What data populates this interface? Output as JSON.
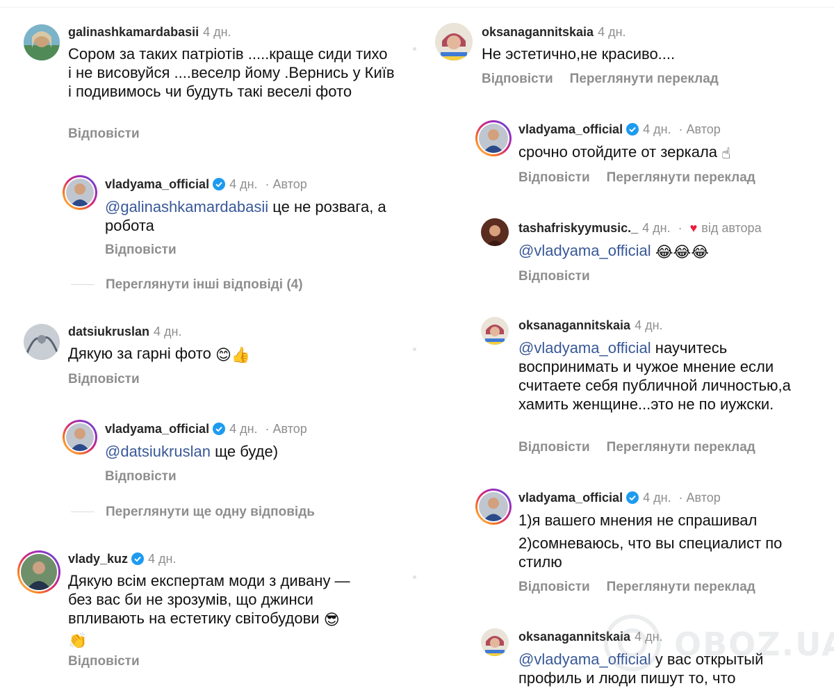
{
  "left_thread": [
    {
      "username": "galinashkamardabasii",
      "time": "4 дн.",
      "text": "Сором за таких патріотів .....краще сиди тихо і не висовуйся ....веселр йому .Вернись у Київ і  подивимось чи будуть такі веселі фото",
      "reply": "Відповісти"
    },
    {
      "username": "vladyama_official",
      "time": "4 дн.",
      "author_label": "Автор",
      "mention": "@galinashkamardabasii",
      "text": " це не розвага, а робота",
      "reply": "Відповісти"
    },
    {
      "view_more": "Переглянути інші відповіді (4)"
    },
    {
      "username": "datsiukruslan",
      "time": "4 дн.",
      "text": "Дякую за гарні фото",
      "reply": "Відповісти"
    },
    {
      "username": "vladyama_official",
      "time": "4 дн.",
      "author_label": "Автор",
      "mention": "@datsiukruslan",
      "text": " ще буде)",
      "reply": "Відповісти"
    },
    {
      "view_more": "Переглянути ще одну відповідь"
    },
    {
      "username": "vlady_kuz",
      "time": "4 дн.",
      "text": "Дякую всім експертам моди з дивану — без вас би не зрозумів, що джинси впливають на естетику світобудови",
      "reply": "Відповісти"
    }
  ],
  "right_thread": [
    {
      "username": "oksanagannitskaia",
      "time": "4 дн.",
      "text": "Не эстетично,не красиво....",
      "reply": "Відповісти",
      "translate": "Переглянути переклад"
    },
    {
      "username": "vladyama_official",
      "time": "4 дн.",
      "author_label": "Автор",
      "text": "срочно отойдите от зеркала",
      "reply": "Відповісти",
      "translate": "Переглянути переклад"
    },
    {
      "username": "tashafriskyymusic._",
      "time": "4 дн.",
      "liked_label": "від автора",
      "mention": "@vladyama_official",
      "reply": "Відповісти"
    },
    {
      "username": "oksanagannitskaia",
      "time": "4 дн.",
      "mention": "@vladyama_official",
      "text": " научитесь воспринимать и чужое мнение если считаете себя публичной личностью,а хамить женщине...это не по иужски.",
      "reply": "Відповісти",
      "translate": "Переглянути переклад"
    },
    {
      "username": "vladyama_official",
      "time": "4 дн.",
      "author_label": "Автор",
      "text_line1": "1)я вашего мнения не спрашивал",
      "text_line2": "2)сомневаюсь, что вы специалист по стилю",
      "reply": "Відповісти",
      "translate": "Переглянути переклад"
    },
    {
      "username": "oksanagannitskaia",
      "time": "4 дн.",
      "mention": "@vladyama_official",
      "text": " у вас открытый профиль и люди пишут то, что"
    }
  ],
  "watermark": "OBOZ.UA",
  "icons": {
    "verified": "verified-badge-icon",
    "heart": "heart-icon"
  },
  "colors": {
    "mention": "#385898",
    "verified": "#1d9bf0",
    "heart": "#ed1c3b",
    "muted": "#8e8e8e"
  }
}
